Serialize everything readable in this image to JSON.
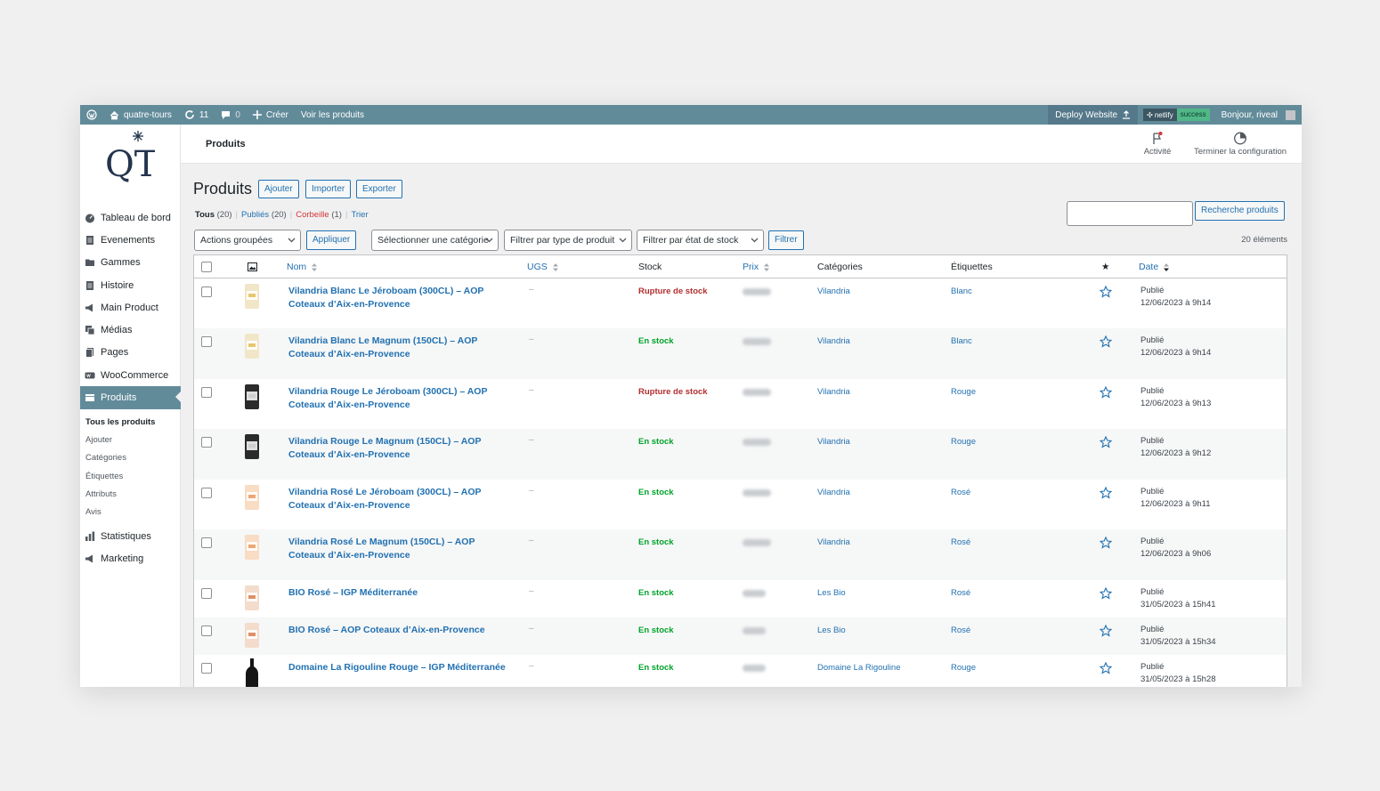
{
  "adminbar": {
    "site_name": "quatre-tours",
    "updates_count": "11",
    "comments_count": "0",
    "create_label": "Créer",
    "view_products_label": "Voir les produits",
    "deploy_label": "Deploy Website",
    "netlify_label": "netlify",
    "netlify_status": "success",
    "greeting": "Bonjour, riveal"
  },
  "logo_text": "QT",
  "sidebar": {
    "items": [
      {
        "label": "Tableau de bord",
        "icon": "dashboard-icon"
      },
      {
        "label": "Evenements",
        "icon": "page-icon"
      },
      {
        "label": "Gammes",
        "icon": "folder-icon"
      },
      {
        "label": "Histoire",
        "icon": "page-icon"
      },
      {
        "label": "Main Product",
        "icon": "megaphone-icon"
      },
      {
        "label": "Médias",
        "icon": "media-icon"
      },
      {
        "label": "Pages",
        "icon": "pages-icon"
      },
      {
        "label": "WooCommerce",
        "icon": "woo-icon"
      },
      {
        "label": "Produits",
        "icon": "archive-icon"
      }
    ],
    "submenu": [
      "Tous les produits",
      "Ajouter",
      "Catégories",
      "Étiquettes",
      "Attributs",
      "Avis"
    ],
    "bottom_items": [
      {
        "label": "Statistiques",
        "icon": "chart-icon"
      },
      {
        "label": "Marketing",
        "icon": "megaphone-icon"
      }
    ]
  },
  "header": {
    "title": "Produits",
    "activity_label": "Activité",
    "setup_label": "Terminer la configuration"
  },
  "page": {
    "title": "Produits",
    "add_button": "Ajouter",
    "import_button": "Importer",
    "export_button": "Exporter",
    "filters": {
      "all_label": "Tous",
      "all_count": "(20)",
      "published_label": "Publiés",
      "published_count": "(20)",
      "trash_label": "Corbeille",
      "trash_count": "(1)",
      "sort_label": "Trier"
    },
    "search_button": "Recherche produits",
    "bulk_actions": "Actions groupées",
    "apply_button": "Appliquer",
    "category_select": "Sélectionner une catégorie",
    "type_select": "Filtrer par type de produit",
    "stock_select": "Filtrer par état de stock",
    "filter_button": "Filtrer",
    "items_count": "20 éléments"
  },
  "table": {
    "columns": {
      "name": "Nom",
      "sku": "UGS",
      "stock": "Stock",
      "price": "Prix",
      "categories": "Catégories",
      "tags": "Étiquettes",
      "featured": "★",
      "date": "Date"
    },
    "rows": [
      {
        "name": "Vilandria Blanc Le Jéroboam (300CL) – AOP Coteaux d’Aix-en-Provence",
        "sku": "–",
        "stock": "Rupture de stock",
        "in_stock": false,
        "category": "Vilandria",
        "tag": "Blanc",
        "status": "Publié",
        "date": "12/06/2023 à 9h14",
        "thumb": "blanc"
      },
      {
        "name": "Vilandria Blanc Le Magnum (150CL) – AOP Coteaux d’Aix-en-Provence",
        "sku": "–",
        "stock": "En stock",
        "in_stock": true,
        "category": "Vilandria",
        "tag": "Blanc",
        "status": "Publié",
        "date": "12/06/2023 à 9h14",
        "thumb": "blanc"
      },
      {
        "name": "Vilandria Rouge Le Jéroboam (300CL) – AOP Coteaux d’Aix-en-Provence",
        "sku": "–",
        "stock": "Rupture de stock",
        "in_stock": false,
        "category": "Vilandria",
        "tag": "Rouge",
        "status": "Publié",
        "date": "12/06/2023 à 9h13",
        "thumb": "rouge"
      },
      {
        "name": "Vilandria Rouge Le Magnum (150CL) – AOP Coteaux d’Aix-en-Provence",
        "sku": "–",
        "stock": "En stock",
        "in_stock": true,
        "category": "Vilandria",
        "tag": "Rouge",
        "status": "Publié",
        "date": "12/06/2023 à 9h12",
        "thumb": "rouge"
      },
      {
        "name": "Vilandria Rosé Le Jéroboam (300CL) – AOP Coteaux d’Aix-en-Provence",
        "sku": "–",
        "stock": "En stock",
        "in_stock": true,
        "category": "Vilandria",
        "tag": "Rosé",
        "status": "Publié",
        "date": "12/06/2023 à 9h11",
        "thumb": "rose"
      },
      {
        "name": "Vilandria Rosé Le Magnum (150CL) – AOP Coteaux d’Aix-en-Provence",
        "sku": "–",
        "stock": "En stock",
        "in_stock": true,
        "category": "Vilandria",
        "tag": "Rosé",
        "status": "Publié",
        "date": "12/06/2023 à 9h06",
        "thumb": "rose"
      },
      {
        "name": "BIO Rosé – IGP Méditerranée",
        "sku": "–",
        "stock": "En stock",
        "in_stock": true,
        "category": "Les Bio",
        "tag": "Rosé",
        "status": "Publié",
        "date": "31/05/2023 à 15h41",
        "thumb": "bio"
      },
      {
        "name": "BIO Rosé – AOP Coteaux d’Aix-en-Provence",
        "sku": "–",
        "stock": "En stock",
        "in_stock": true,
        "category": "Les Bio",
        "tag": "Rosé",
        "status": "Publié",
        "date": "31/05/2023 à 15h34",
        "thumb": "bio"
      },
      {
        "name": "Domaine La Rigouline Rouge – IGP Méditerranée",
        "sku": "–",
        "stock": "En stock",
        "in_stock": true,
        "category": "Domaine La Rigouline",
        "tag": "Rouge",
        "status": "Publié",
        "date": "31/05/2023 à 15h28",
        "thumb": "dark"
      }
    ]
  },
  "colors": {
    "admin_bar": "#628b9a",
    "link": "#2271b1",
    "out_of_stock": "#b32d2e",
    "in_stock": "#00a32a"
  }
}
